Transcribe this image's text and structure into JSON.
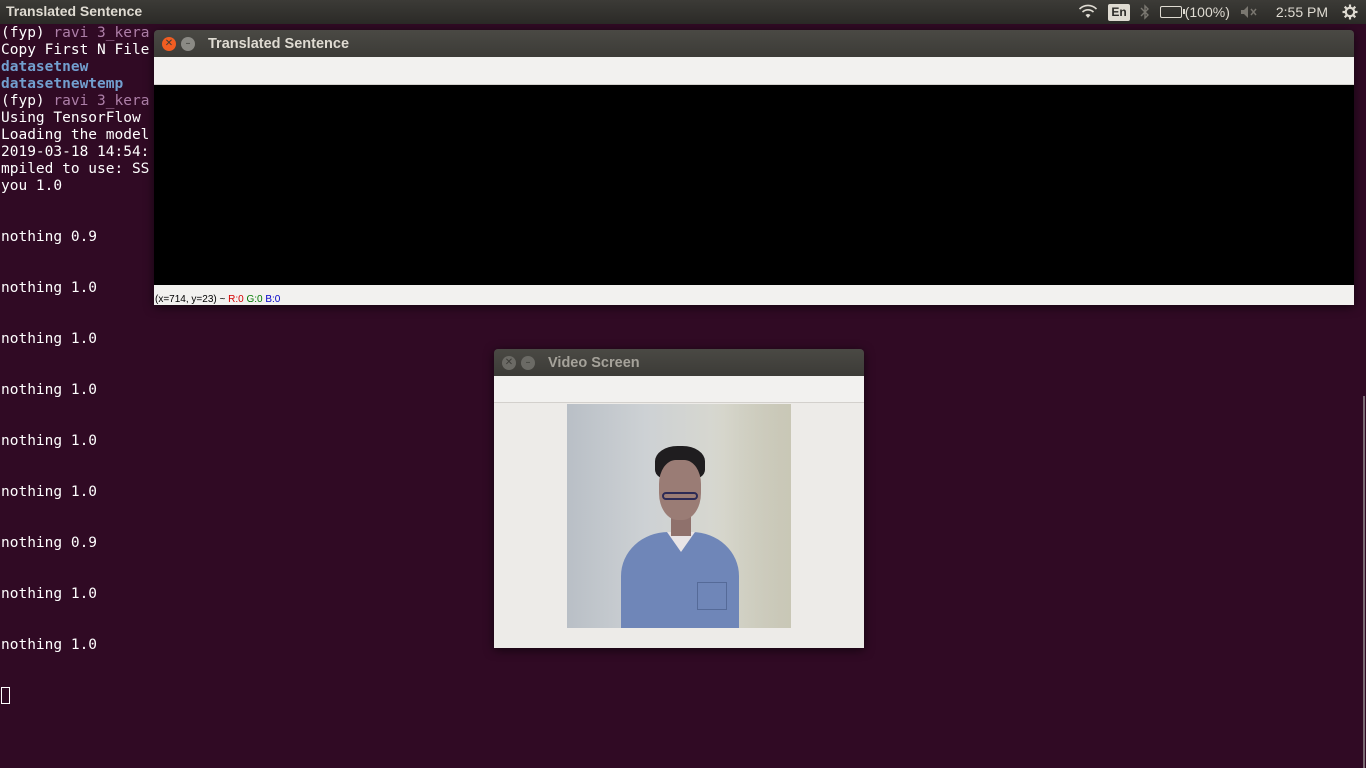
{
  "top_panel": {
    "title": "Translated Sentence",
    "indicators": {
      "wifi_icon": "wifi-icon",
      "keyboard_layout": "En",
      "bluetooth_icon": "bluetooth-icon",
      "battery_icon": "battery-icon",
      "battery_text": "(100%)",
      "sound_icon": "sound-muted-icon",
      "clock": "2:55 PM",
      "settings_icon": "gear-icon"
    }
  },
  "terminal": {
    "lines": [
      {
        "prefix": "(fyp) ",
        "user": "ravi 3_kera"
      },
      {
        "text": "Copy First N File"
      },
      {
        "dir": "datasetnew"
      },
      {
        "dir": "datasetnewtemp"
      },
      {
        "prefix": "(fyp) ",
        "user": "ravi 3_kera"
      },
      {
        "text": "Using TensorFlow"
      },
      {
        "text": "Loading the model"
      },
      {
        "text": "2019-03-18 14:54:"
      },
      {
        "text": "mpiled to use: SS"
      },
      {
        "text": "you 1.0"
      },
      {
        "text": "nothing 0.9"
      },
      {
        "text": "nothing 1.0"
      },
      {
        "text": "nothing 1.0"
      },
      {
        "text": "nothing 1.0"
      },
      {
        "text": "nothing 1.0"
      },
      {
        "text": "nothing 1.0"
      },
      {
        "text": "nothing 0.9"
      },
      {
        "text": "nothing 1.0"
      },
      {
        "text": "nothing 1.0"
      }
    ]
  },
  "translated_window": {
    "title": "Translated Sentence",
    "status": {
      "coords": "(x=714, y=23) ~ ",
      "r": "R:0",
      "g": "G:0",
      "b": "B:0"
    }
  },
  "video_window": {
    "title": "Video Screen"
  },
  "colors": {
    "terminal_bg": "#300a24",
    "close_button": "#f15d22",
    "panel_bg": "#3c3b37"
  }
}
